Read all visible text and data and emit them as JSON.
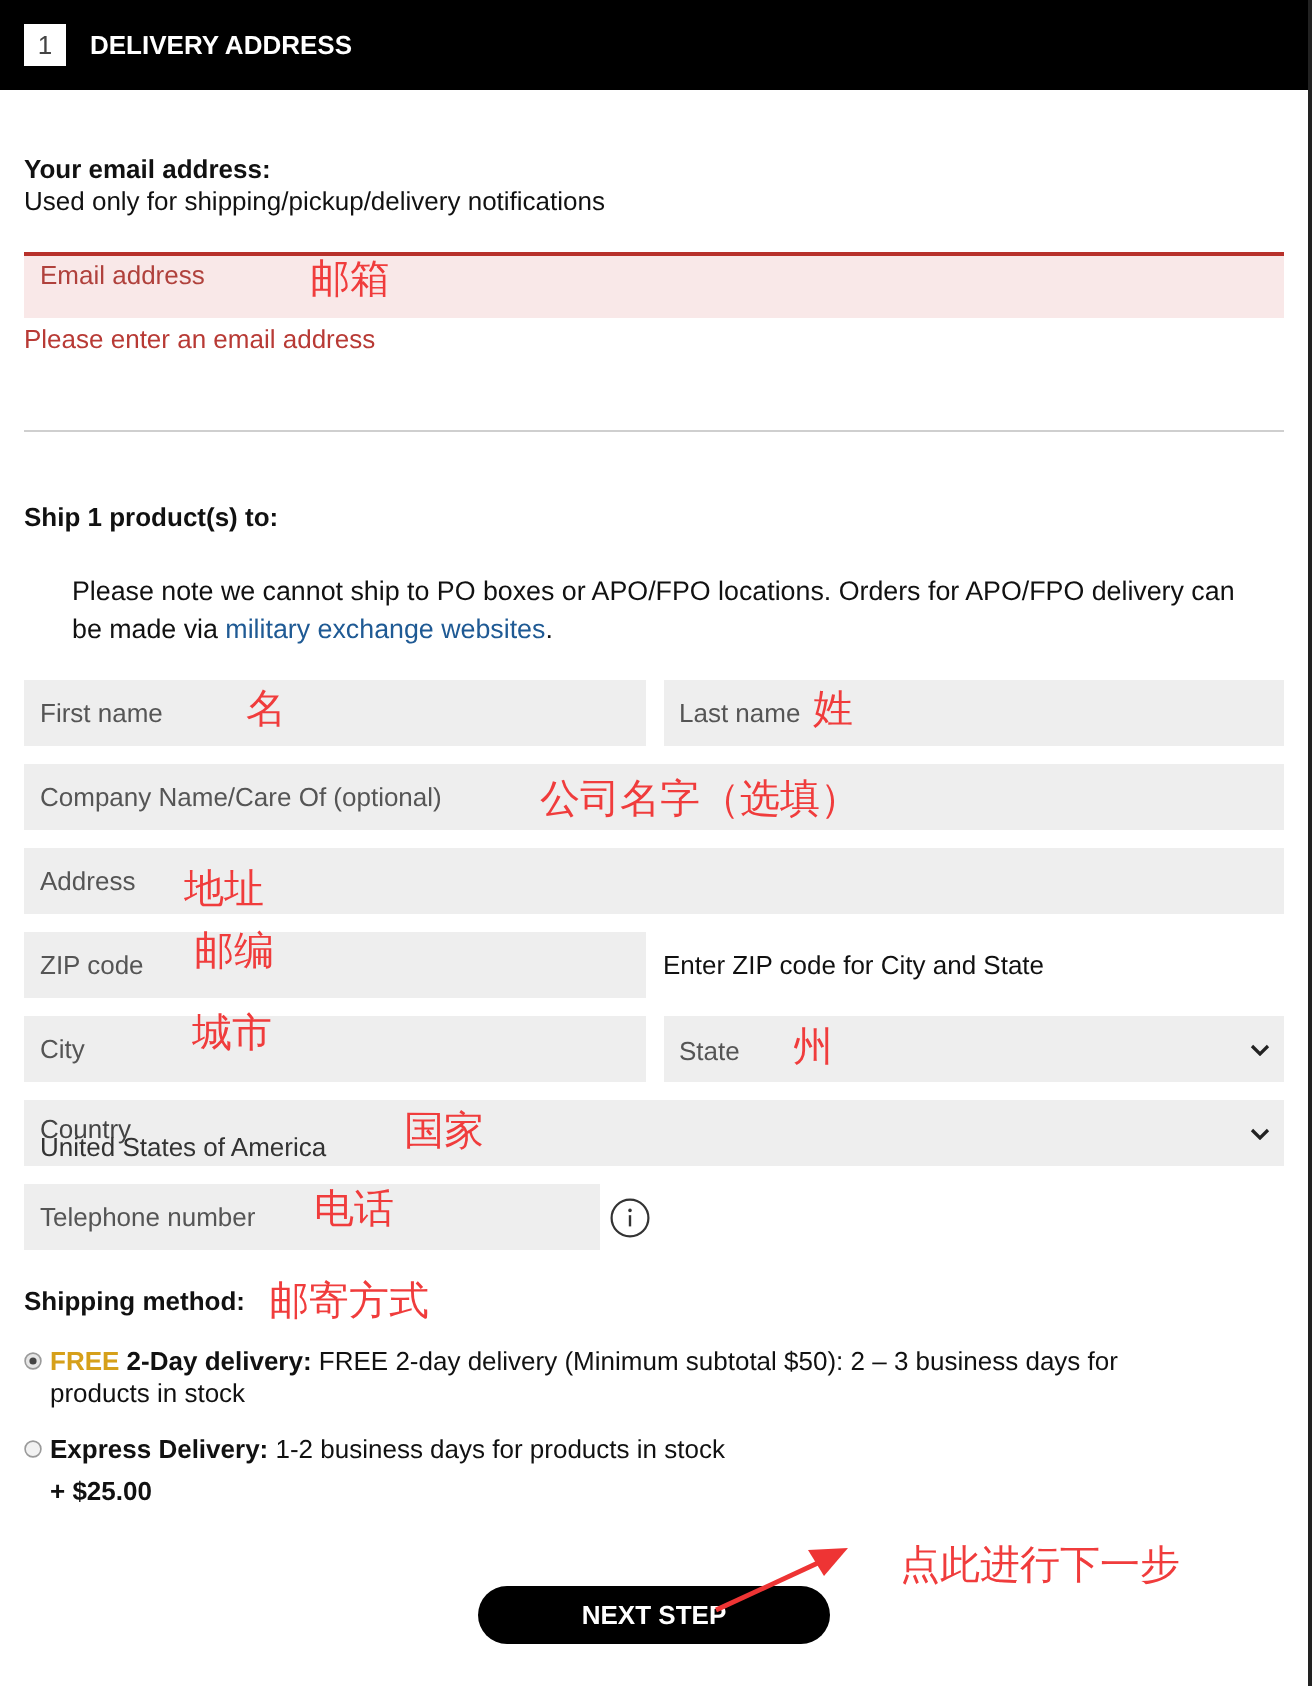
{
  "header": {
    "step": "1",
    "title": "DELIVERY ADDRESS"
  },
  "email": {
    "heading": "Your email address:",
    "subheading": "Used only for shipping/pickup/delivery notifications",
    "field": {
      "placeholder": "Email address",
      "annotation": "邮箱",
      "invalid": true
    },
    "error": "Please enter an email address"
  },
  "shipping_address": {
    "heading": "Ship 1 product(s) to:",
    "note": {
      "text": "Please note we cannot ship to PO boxes or APO/FPO locations. Orders for APO/FPO delivery can be made via",
      "link": "military exchange websites",
      "text_after": "."
    },
    "rows": [
      [
        {
          "kind": "input",
          "placeholder": "First name",
          "annotation": "名"
        },
        {
          "kind": "input",
          "placeholder": "Last name",
          "annotation": "姓"
        }
      ],
      [
        {
          "kind": "input",
          "placeholder": "Company Name/Care Of (optional)",
          "annotation": "公司名字（选填）"
        }
      ],
      [
        {
          "kind": "input",
          "placeholder": "Address",
          "annotation": "地址"
        }
      ],
      [
        {
          "kind": "input",
          "placeholder": "ZIP code",
          "annotation": "邮编"
        },
        {
          "kind": "hint",
          "text": "Enter ZIP code for City and State"
        }
      ],
      [
        {
          "kind": "input",
          "placeholder": "City",
          "annotation": "城市"
        },
        {
          "kind": "select",
          "placeholder": "State",
          "annotation": "州"
        }
      ],
      [
        {
          "kind": "select",
          "label": "Country",
          "value": "United States of America",
          "annotation": "国家"
        }
      ],
      [
        {
          "kind": "input",
          "placeholder": "Telephone number",
          "annotation": "电话"
        },
        {
          "kind": "info"
        }
      ]
    ]
  },
  "shipping_method": {
    "heading": "Shipping method:",
    "annotation": "邮寄方式",
    "options": [
      {
        "badge": "FREE",
        "title": "2-Day delivery:",
        "description": "FREE 2-day delivery (Minimum subtotal $50): 2 – 3 business days for products in stock",
        "selected": true
      },
      {
        "title": "Express Delivery:",
        "description": "1-2 business days for products in stock",
        "price": "+ $25.00",
        "selected": false
      }
    ]
  },
  "next_button": {
    "label": "NEXT STEP",
    "annotation": "点此进行下一步"
  }
}
